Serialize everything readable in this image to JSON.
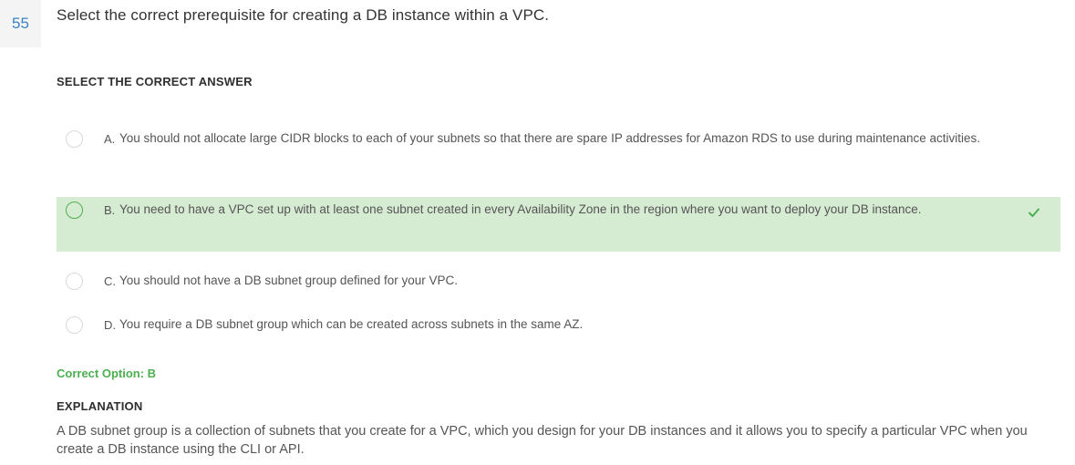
{
  "question": {
    "number": "55",
    "text": "Select the correct prerequisite for creating a DB instance within a VPC."
  },
  "select_heading": "SELECT THE CORRECT ANSWER",
  "options": [
    {
      "letter": "A.",
      "text": "You should not allocate large CIDR blocks to each of your subnets so that there are spare IP addresses for Amazon RDS to use during maintenance activities.",
      "correct": false
    },
    {
      "letter": "B.",
      "text": "You need to have a VPC set up with at least one subnet created in every Availability Zone in the region where you want to deploy your DB instance.",
      "correct": true
    },
    {
      "letter": "C.",
      "text": "You should not have a DB subnet group defined for your VPC.",
      "correct": false
    },
    {
      "letter": "D.",
      "text": "You require a DB subnet group which can be created across subnets in the same AZ.",
      "correct": false
    }
  ],
  "correct_option": "Correct Option: B",
  "explanation_heading": "EXPLANATION",
  "explanation_text": "A DB subnet group is a collection of subnets that you create for a VPC, which you design for your DB instances and it allows you to specify a particular VPC when you create a DB instance using the CLI or API.",
  "colors": {
    "accent_blue": "#3b83c4",
    "correct_green": "#4caf50",
    "correct_bg": "#d6ecd2"
  },
  "icons": {
    "correct_mark": "check-icon"
  }
}
